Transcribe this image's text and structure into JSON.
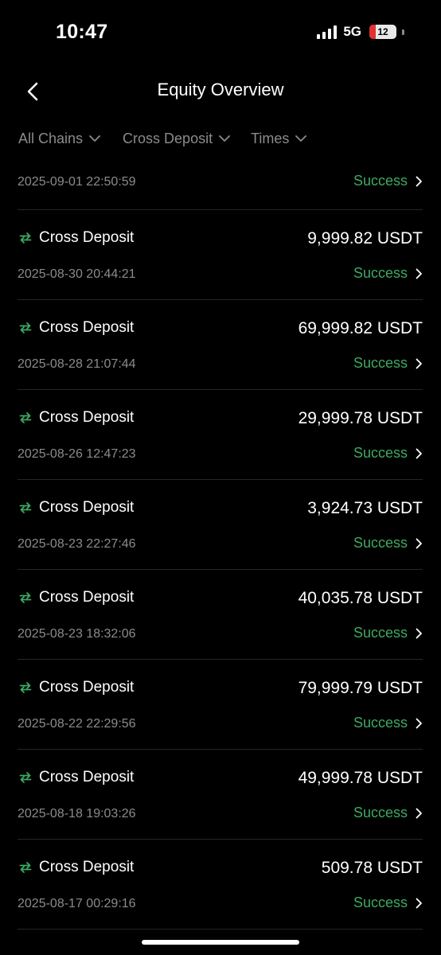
{
  "status_bar": {
    "time": "10:47",
    "network": "5G",
    "battery": "12"
  },
  "header": {
    "title": "Equity Overview",
    "back_icon": "chevron-left-icon"
  },
  "filters": [
    {
      "label": "All Chains"
    },
    {
      "label": "Cross Deposit"
    },
    {
      "label": "Times"
    }
  ],
  "top_partial": {
    "timestamp": "2025-09-01 22:50:59",
    "status": "Success"
  },
  "transactions": [
    {
      "type": "Cross Deposit",
      "amount": "9,999.82 USDT",
      "timestamp": "2025-08-30 20:44:21",
      "status": "Success"
    },
    {
      "type": "Cross Deposit",
      "amount": "69,999.82 USDT",
      "timestamp": "2025-08-28 21:07:44",
      "status": "Success"
    },
    {
      "type": "Cross Deposit",
      "amount": "29,999.78 USDT",
      "timestamp": "2025-08-26 12:47:23",
      "status": "Success"
    },
    {
      "type": "Cross Deposit",
      "amount": "3,924.73 USDT",
      "timestamp": "2025-08-23 22:27:46",
      "status": "Success"
    },
    {
      "type": "Cross Deposit",
      "amount": "40,035.78 USDT",
      "timestamp": "2025-08-23 18:32:06",
      "status": "Success"
    },
    {
      "type": "Cross Deposit",
      "amount": "79,999.79 USDT",
      "timestamp": "2025-08-22 22:29:56",
      "status": "Success"
    },
    {
      "type": "Cross Deposit",
      "amount": "49,999.78 USDT",
      "timestamp": "2025-08-18 19:03:26",
      "status": "Success"
    },
    {
      "type": "Cross Deposit",
      "amount": "509.78 USDT",
      "timestamp": "2025-08-17 00:29:16",
      "status": "Success"
    }
  ],
  "colors": {
    "background": "#000000",
    "success": "#3daa62",
    "muted": "#8b8b8b",
    "transfer_icon": "#3daa62"
  }
}
